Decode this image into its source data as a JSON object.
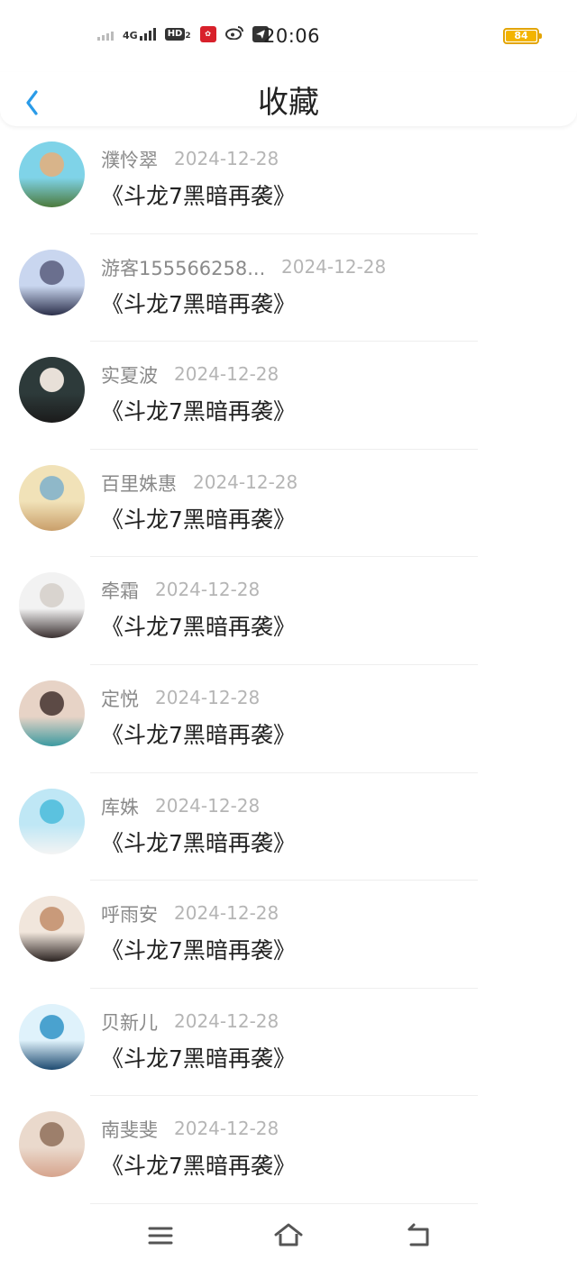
{
  "status_bar": {
    "network": "4G",
    "hd": "HD",
    "hd_sub": "2",
    "time": "20:06",
    "battery": "84",
    "icons": [
      "signal-weak-icon",
      "signal-4g-icon",
      "hd-icon",
      "app-red-icon",
      "weibo-icon",
      "telegram-icon",
      "battery-icon"
    ]
  },
  "header": {
    "title": "收藏",
    "back_icon": "back-chevron-icon"
  },
  "favorites": [
    {
      "user": "濮怜翠",
      "date": "2024-12-28",
      "book": "《斗龙7黑暗再袭》"
    },
    {
      "user": "游客155566258...",
      "date": "2024-12-28",
      "book": "《斗龙7黑暗再袭》"
    },
    {
      "user": "实夏波",
      "date": "2024-12-28",
      "book": "《斗龙7黑暗再袭》"
    },
    {
      "user": "百里姝惠",
      "date": "2024-12-28",
      "book": "《斗龙7黑暗再袭》"
    },
    {
      "user": "牵霜",
      "date": "2024-12-28",
      "book": "《斗龙7黑暗再袭》"
    },
    {
      "user": "定悦",
      "date": "2024-12-28",
      "book": "《斗龙7黑暗再袭》"
    },
    {
      "user": "库姝",
      "date": "2024-12-28",
      "book": "《斗龙7黑暗再袭》"
    },
    {
      "user": "呼雨安",
      "date": "2024-12-28",
      "book": "《斗龙7黑暗再袭》"
    },
    {
      "user": "贝新儿",
      "date": "2024-12-28",
      "book": "《斗龙7黑暗再袭》"
    },
    {
      "user": "南斐斐",
      "date": "2024-12-28",
      "book": "《斗龙7黑暗再袭》"
    }
  ],
  "bottom_nav": {
    "icons": [
      "menu-icon",
      "home-icon",
      "back-icon"
    ]
  },
  "colors": {
    "accent": "#2a9be8",
    "name_text": "#8a8a8a",
    "date_text": "#b5b5b5",
    "title_text": "#222222"
  }
}
